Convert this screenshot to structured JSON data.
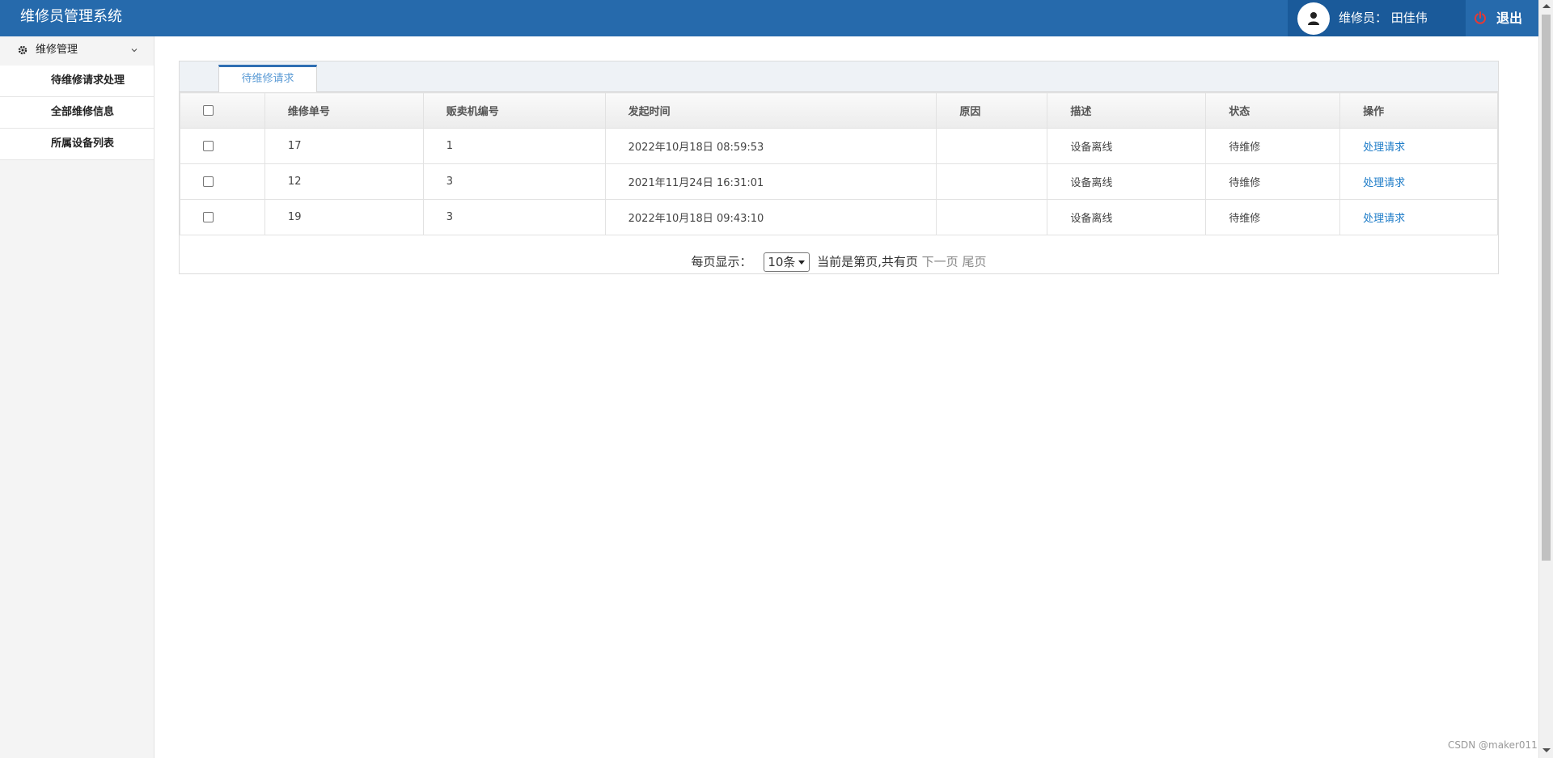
{
  "app": {
    "title": "维修员管理系统"
  },
  "user": {
    "label": "维修员：  田佳伟"
  },
  "header": {
    "logout_label": "退出"
  },
  "sidebar": {
    "group_label": "维修管理",
    "items": [
      {
        "label": "待维修请求处理"
      },
      {
        "label": "全部维修信息"
      },
      {
        "label": "所属设备列表"
      }
    ]
  },
  "tabs": [
    {
      "label": "待维修请求"
    }
  ],
  "table": {
    "headers": [
      "",
      "维修单号",
      "贩卖机编号",
      "发起时间",
      "原因",
      "描述",
      "状态",
      "操作"
    ],
    "rows": [
      {
        "id": "17",
        "machine": "1",
        "time": "2022年10月18日 08:59:53",
        "reason": "",
        "desc": "设备离线",
        "status": "待维修",
        "action": "处理请求"
      },
      {
        "id": "12",
        "machine": "3",
        "time": "2021年11月24日 16:31:01",
        "reason": "",
        "desc": "设备离线",
        "status": "待维修",
        "action": "处理请求"
      },
      {
        "id": "19",
        "machine": "3",
        "time": "2022年10月18日 09:43:10",
        "reason": "",
        "desc": "设备离线",
        "status": "待维修",
        "action": "处理请求"
      }
    ]
  },
  "pager": {
    "per_page_label": "每页显示：",
    "per_page_value": "10条",
    "status_text": "当前是第页,共有页",
    "next_label": "下一页",
    "last_label": "尾页"
  },
  "watermark": "CSDN @maker011",
  "colors": {
    "header": "#266aac",
    "link": "#1e7cc8",
    "tab_accent": "#2f6fb3"
  }
}
